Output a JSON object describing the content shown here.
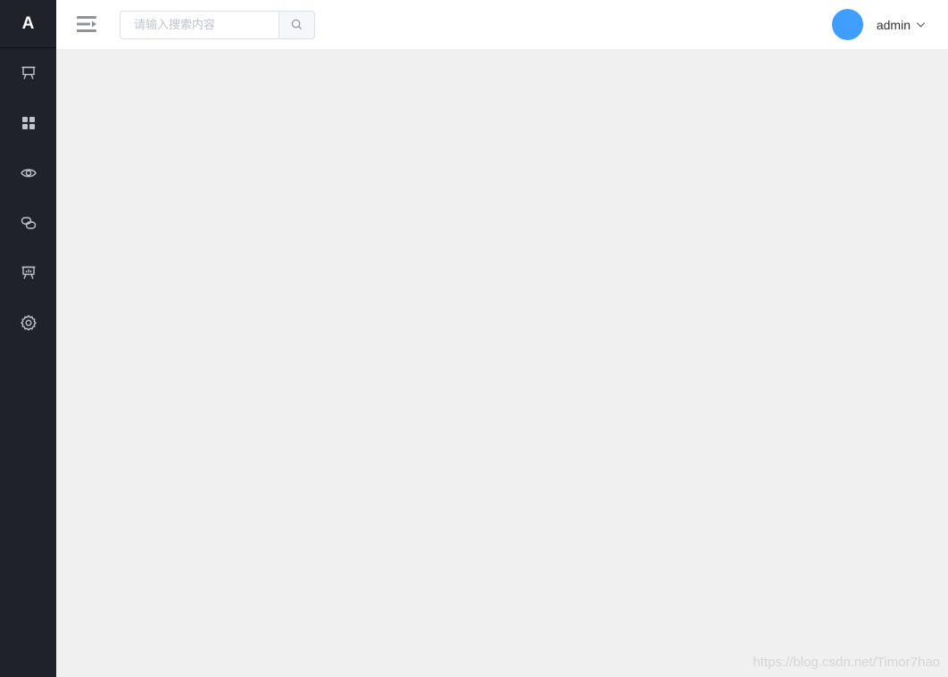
{
  "sidebar": {
    "logo": "A",
    "items": [
      {
        "icon": "presentation-icon"
      },
      {
        "icon": "grid-icon"
      },
      {
        "icon": "eye-icon"
      },
      {
        "icon": "link-icon"
      },
      {
        "icon": "chart-board-icon"
      },
      {
        "icon": "gear-icon"
      }
    ]
  },
  "header": {
    "menu_toggle_icon": "menu-fold-icon",
    "search": {
      "placeholder": "请输入搜索内容",
      "value": "",
      "button_icon": "search-icon"
    },
    "user": {
      "name": "admin",
      "dropdown_icon": "chevron-down-icon",
      "avatar_color": "#409eff"
    }
  },
  "watermark": "https://blog.csdn.net/Timor7hao",
  "colors": {
    "sidebar_bg": "#1f222b",
    "main_bg": "#f0f0f0",
    "accent": "#409eff"
  }
}
